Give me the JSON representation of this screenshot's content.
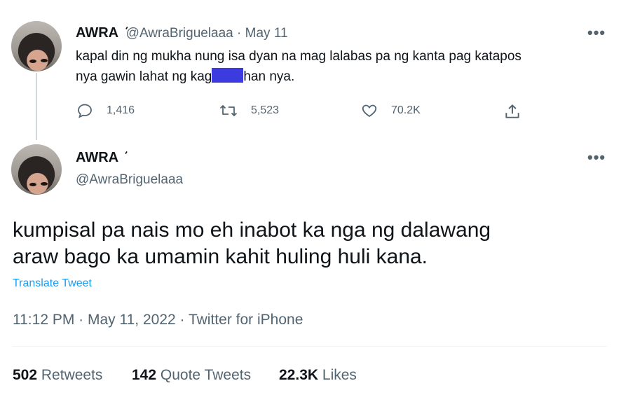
{
  "reply_tweet": {
    "name": "AWRA",
    "name_suffix": "ܿ",
    "handle": "@AwraBriguelaaa",
    "separator": "·",
    "date": "May 11",
    "text_part1": "kapal din ng mukha nung isa dyan na mag lalabas pa ng kanta pag katapos",
    "text_part2": "nya gawin lahat ng kag",
    "text_part3": "han nya.",
    "more": "•••",
    "replies": "1,416",
    "retweets": "5,523",
    "likes": "70.2K"
  },
  "main_tweet": {
    "name": "AWRA",
    "name_suffix": "ܿ",
    "handle": "@AwraBriguelaaa",
    "more": "•••",
    "text_line1": "kumpisal pa nais mo eh inabot ka nga ng dalawang",
    "text_line2": "araw bago ka umamin kahit huling huli kana.",
    "translate": "Translate Tweet",
    "meta": "11:12 PM · May 11, 2022 · Twitter for iPhone",
    "stats": {
      "retweets_count": "502",
      "retweets_label": "Retweets",
      "quotes_count": "142",
      "quotes_label": "Quote Tweets",
      "likes_count": "22.3K",
      "likes_label": "Likes"
    }
  }
}
